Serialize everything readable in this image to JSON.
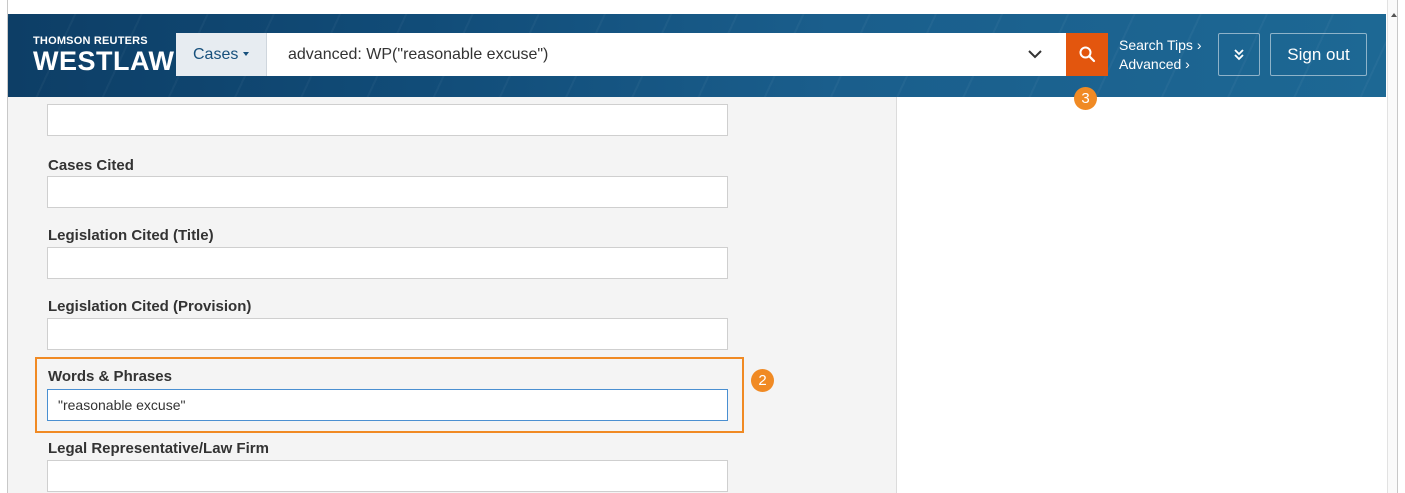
{
  "header": {
    "brand_top": "THOMSON REUTERS",
    "brand_main": "WESTLAW",
    "scope_label": "Cases",
    "query": "advanced: WP(\"reasonable excuse\")",
    "search_tips": "Search Tips ›",
    "advanced": "Advanced ›",
    "sign_out": "Sign out"
  },
  "form": {
    "fields": [
      {
        "label": "Cases Cited",
        "value": ""
      },
      {
        "label": "Legislation Cited (Title)",
        "value": ""
      },
      {
        "label": "Legislation Cited (Provision)",
        "value": ""
      },
      {
        "label": "Words & Phrases",
        "value": "\"reasonable excuse\""
      },
      {
        "label": "Legal Representative/Law Firm",
        "value": ""
      }
    ]
  },
  "annotations": {
    "step_2": "2",
    "step_3": "3"
  },
  "icons": {
    "search": "search-icon",
    "chevron": "chevron-down-icon",
    "more": "double-chevron-down-icon"
  },
  "colors": {
    "header": "#114c78",
    "accent": "#e3560e",
    "highlight": "#f08a24"
  }
}
